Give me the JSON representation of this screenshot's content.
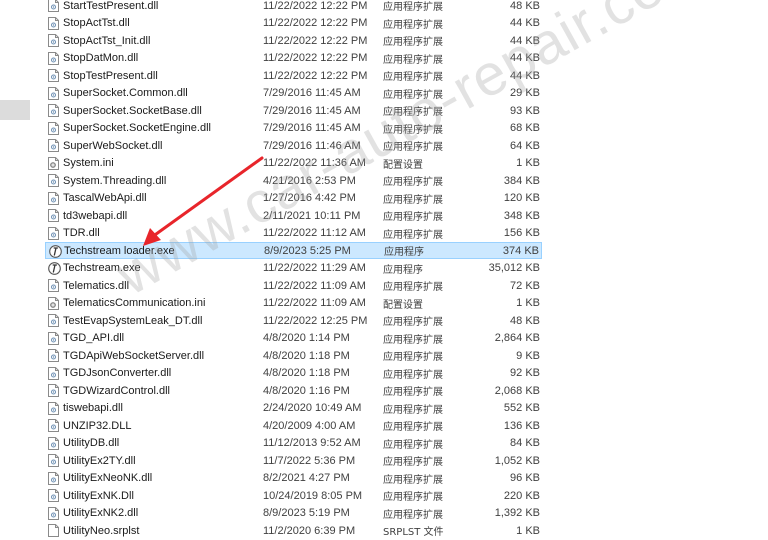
{
  "files": [
    {
      "name": "StartTestPresent.dll",
      "date": "11/22/2022 12:22 PM",
      "type": "应用程序扩展",
      "size": "48 KB",
      "icon": "dll-file-icon"
    },
    {
      "name": "StopActTst.dll",
      "date": "11/22/2022 12:22 PM",
      "type": "应用程序扩展",
      "size": "44 KB",
      "icon": "dll-file-icon"
    },
    {
      "name": "StopActTst_Init.dll",
      "date": "11/22/2022 12:22 PM",
      "type": "应用程序扩展",
      "size": "44 KB",
      "icon": "dll-file-icon"
    },
    {
      "name": "StopDatMon.dll",
      "date": "11/22/2022 12:22 PM",
      "type": "应用程序扩展",
      "size": "44 KB",
      "icon": "dll-file-icon"
    },
    {
      "name": "StopTestPresent.dll",
      "date": "11/22/2022 12:22 PM",
      "type": "应用程序扩展",
      "size": "44 KB",
      "icon": "dll-file-icon"
    },
    {
      "name": "SuperSocket.Common.dll",
      "date": "7/29/2016 11:45 AM",
      "type": "应用程序扩展",
      "size": "29 KB",
      "icon": "dll-file-icon"
    },
    {
      "name": "SuperSocket.SocketBase.dll",
      "date": "7/29/2016 11:45 AM",
      "type": "应用程序扩展",
      "size": "93 KB",
      "icon": "dll-file-icon"
    },
    {
      "name": "SuperSocket.SocketEngine.dll",
      "date": "7/29/2016 11:45 AM",
      "type": "应用程序扩展",
      "size": "68 KB",
      "icon": "dll-file-icon"
    },
    {
      "name": "SuperWebSocket.dll",
      "date": "7/29/2016 11:46 AM",
      "type": "应用程序扩展",
      "size": "64 KB",
      "icon": "dll-file-icon"
    },
    {
      "name": "System.ini",
      "date": "11/22/2022 11:36 AM",
      "type": "配置设置",
      "size": "1 KB",
      "icon": "ini-file-icon"
    },
    {
      "name": "System.Threading.dll",
      "date": "4/21/2016 2:53 PM",
      "type": "应用程序扩展",
      "size": "384 KB",
      "icon": "dll-file-icon"
    },
    {
      "name": "TascalWebApi.dll",
      "date": "1/27/2016 4:42 PM",
      "type": "应用程序扩展",
      "size": "120 KB",
      "icon": "dll-file-icon"
    },
    {
      "name": "td3webapi.dll",
      "date": "2/11/2021 10:11 PM",
      "type": "应用程序扩展",
      "size": "348 KB",
      "icon": "dll-file-icon"
    },
    {
      "name": "TDR.dll",
      "date": "11/22/2022 11:12 AM",
      "type": "应用程序扩展",
      "size": "156 KB",
      "icon": "dll-file-icon"
    },
    {
      "name": "Techstream loader.exe",
      "date": "8/9/2023 5:25 PM",
      "type": "应用程序",
      "size": "374 KB",
      "icon": "techstream-exe-icon",
      "selected": true
    },
    {
      "name": "Techstream.exe",
      "date": "11/22/2022 11:29 AM",
      "type": "应用程序",
      "size": "35,012 KB",
      "icon": "techstream-exe-icon"
    },
    {
      "name": "Telematics.dll",
      "date": "11/22/2022 11:09 AM",
      "type": "应用程序扩展",
      "size": "72 KB",
      "icon": "dll-file-icon"
    },
    {
      "name": "TelematicsCommunication.ini",
      "date": "11/22/2022 11:09 AM",
      "type": "配置设置",
      "size": "1 KB",
      "icon": "ini-file-icon"
    },
    {
      "name": "TestEvapSystemLeak_DT.dll",
      "date": "11/22/2022 12:25 PM",
      "type": "应用程序扩展",
      "size": "48 KB",
      "icon": "dll-file-icon"
    },
    {
      "name": "TGD_API.dll",
      "date": "4/8/2020 1:14 PM",
      "type": "应用程序扩展",
      "size": "2,864 KB",
      "icon": "dll-file-icon"
    },
    {
      "name": "TGDApiWebSocketServer.dll",
      "date": "4/8/2020 1:18 PM",
      "type": "应用程序扩展",
      "size": "9 KB",
      "icon": "dll-file-icon"
    },
    {
      "name": "TGDJsonConverter.dll",
      "date": "4/8/2020 1:18 PM",
      "type": "应用程序扩展",
      "size": "92 KB",
      "icon": "dll-file-icon"
    },
    {
      "name": "TGDWizardControl.dll",
      "date": "4/8/2020 1:16 PM",
      "type": "应用程序扩展",
      "size": "2,068 KB",
      "icon": "dll-file-icon"
    },
    {
      "name": "tiswebapi.dll",
      "date": "2/24/2020 10:49 AM",
      "type": "应用程序扩展",
      "size": "552 KB",
      "icon": "dll-file-icon"
    },
    {
      "name": "UNZIP32.DLL",
      "date": "4/20/2009 4:00 AM",
      "type": "应用程序扩展",
      "size": "136 KB",
      "icon": "dll-file-icon"
    },
    {
      "name": "UtilityDB.dll",
      "date": "11/12/2013 9:52 AM",
      "type": "应用程序扩展",
      "size": "84 KB",
      "icon": "dll-file-icon"
    },
    {
      "name": "UtilityEx2TY.dll",
      "date": "11/7/2022 5:36 PM",
      "type": "应用程序扩展",
      "size": "1,052 KB",
      "icon": "dll-file-icon"
    },
    {
      "name": "UtilityExNeoNK.dll",
      "date": "8/2/2021 4:27 PM",
      "type": "应用程序扩展",
      "size": "96 KB",
      "icon": "dll-file-icon"
    },
    {
      "name": "UtilityExNK.Dll",
      "date": "10/24/2019 8:05 PM",
      "type": "应用程序扩展",
      "size": "220 KB",
      "icon": "dll-file-icon"
    },
    {
      "name": "UtilityExNK2.dll",
      "date": "8/9/2023 5:19 PM",
      "type": "应用程序扩展",
      "size": "1,392 KB",
      "icon": "dll-file-icon"
    },
    {
      "name": "UtilityNeo.srplst",
      "date": "11/2/2020 6:39 PM",
      "type": "SRPLST 文件",
      "size": "1 KB",
      "icon": "generic-file-icon"
    }
  ],
  "watermark": "www.car-auto-repair.com",
  "colors": {
    "selection": "#cce8ff",
    "selection_border": "#99d1ff",
    "arrow": "#e8252b"
  }
}
